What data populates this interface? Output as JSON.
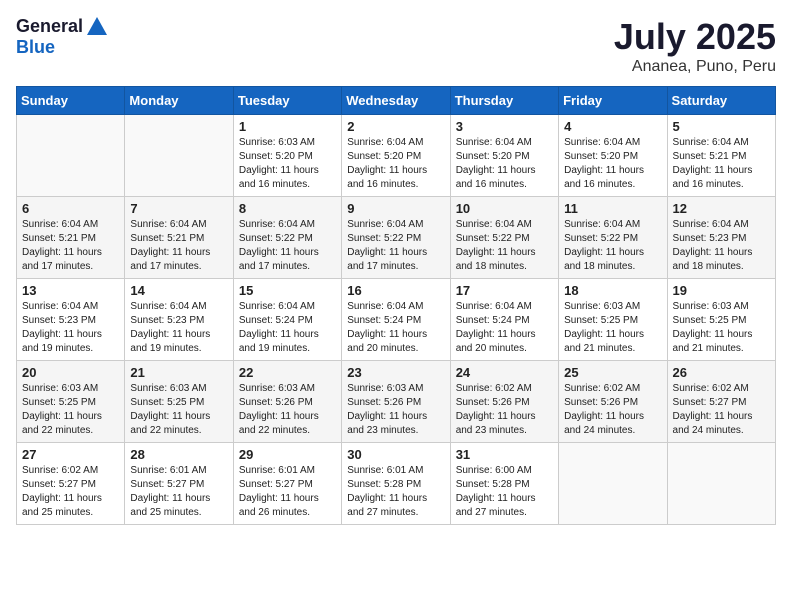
{
  "header": {
    "logo_general": "General",
    "logo_blue": "Blue",
    "month_title": "July 2025",
    "subtitle": "Ananea, Puno, Peru"
  },
  "weekdays": [
    "Sunday",
    "Monday",
    "Tuesday",
    "Wednesday",
    "Thursday",
    "Friday",
    "Saturday"
  ],
  "weeks": [
    [
      {
        "day": "",
        "info": ""
      },
      {
        "day": "",
        "info": ""
      },
      {
        "day": "1",
        "info": "Sunrise: 6:03 AM\nSunset: 5:20 PM\nDaylight: 11 hours and 16 minutes."
      },
      {
        "day": "2",
        "info": "Sunrise: 6:04 AM\nSunset: 5:20 PM\nDaylight: 11 hours and 16 minutes."
      },
      {
        "day": "3",
        "info": "Sunrise: 6:04 AM\nSunset: 5:20 PM\nDaylight: 11 hours and 16 minutes."
      },
      {
        "day": "4",
        "info": "Sunrise: 6:04 AM\nSunset: 5:20 PM\nDaylight: 11 hours and 16 minutes."
      },
      {
        "day": "5",
        "info": "Sunrise: 6:04 AM\nSunset: 5:21 PM\nDaylight: 11 hours and 16 minutes."
      }
    ],
    [
      {
        "day": "6",
        "info": "Sunrise: 6:04 AM\nSunset: 5:21 PM\nDaylight: 11 hours and 17 minutes."
      },
      {
        "day": "7",
        "info": "Sunrise: 6:04 AM\nSunset: 5:21 PM\nDaylight: 11 hours and 17 minutes."
      },
      {
        "day": "8",
        "info": "Sunrise: 6:04 AM\nSunset: 5:22 PM\nDaylight: 11 hours and 17 minutes."
      },
      {
        "day": "9",
        "info": "Sunrise: 6:04 AM\nSunset: 5:22 PM\nDaylight: 11 hours and 17 minutes."
      },
      {
        "day": "10",
        "info": "Sunrise: 6:04 AM\nSunset: 5:22 PM\nDaylight: 11 hours and 18 minutes."
      },
      {
        "day": "11",
        "info": "Sunrise: 6:04 AM\nSunset: 5:22 PM\nDaylight: 11 hours and 18 minutes."
      },
      {
        "day": "12",
        "info": "Sunrise: 6:04 AM\nSunset: 5:23 PM\nDaylight: 11 hours and 18 minutes."
      }
    ],
    [
      {
        "day": "13",
        "info": "Sunrise: 6:04 AM\nSunset: 5:23 PM\nDaylight: 11 hours and 19 minutes."
      },
      {
        "day": "14",
        "info": "Sunrise: 6:04 AM\nSunset: 5:23 PM\nDaylight: 11 hours and 19 minutes."
      },
      {
        "day": "15",
        "info": "Sunrise: 6:04 AM\nSunset: 5:24 PM\nDaylight: 11 hours and 19 minutes."
      },
      {
        "day": "16",
        "info": "Sunrise: 6:04 AM\nSunset: 5:24 PM\nDaylight: 11 hours and 20 minutes."
      },
      {
        "day": "17",
        "info": "Sunrise: 6:04 AM\nSunset: 5:24 PM\nDaylight: 11 hours and 20 minutes."
      },
      {
        "day": "18",
        "info": "Sunrise: 6:03 AM\nSunset: 5:25 PM\nDaylight: 11 hours and 21 minutes."
      },
      {
        "day": "19",
        "info": "Sunrise: 6:03 AM\nSunset: 5:25 PM\nDaylight: 11 hours and 21 minutes."
      }
    ],
    [
      {
        "day": "20",
        "info": "Sunrise: 6:03 AM\nSunset: 5:25 PM\nDaylight: 11 hours and 22 minutes."
      },
      {
        "day": "21",
        "info": "Sunrise: 6:03 AM\nSunset: 5:25 PM\nDaylight: 11 hours and 22 minutes."
      },
      {
        "day": "22",
        "info": "Sunrise: 6:03 AM\nSunset: 5:26 PM\nDaylight: 11 hours and 22 minutes."
      },
      {
        "day": "23",
        "info": "Sunrise: 6:03 AM\nSunset: 5:26 PM\nDaylight: 11 hours and 23 minutes."
      },
      {
        "day": "24",
        "info": "Sunrise: 6:02 AM\nSunset: 5:26 PM\nDaylight: 11 hours and 23 minutes."
      },
      {
        "day": "25",
        "info": "Sunrise: 6:02 AM\nSunset: 5:26 PM\nDaylight: 11 hours and 24 minutes."
      },
      {
        "day": "26",
        "info": "Sunrise: 6:02 AM\nSunset: 5:27 PM\nDaylight: 11 hours and 24 minutes."
      }
    ],
    [
      {
        "day": "27",
        "info": "Sunrise: 6:02 AM\nSunset: 5:27 PM\nDaylight: 11 hours and 25 minutes."
      },
      {
        "day": "28",
        "info": "Sunrise: 6:01 AM\nSunset: 5:27 PM\nDaylight: 11 hours and 25 minutes."
      },
      {
        "day": "29",
        "info": "Sunrise: 6:01 AM\nSunset: 5:27 PM\nDaylight: 11 hours and 26 minutes."
      },
      {
        "day": "30",
        "info": "Sunrise: 6:01 AM\nSunset: 5:28 PM\nDaylight: 11 hours and 27 minutes."
      },
      {
        "day": "31",
        "info": "Sunrise: 6:00 AM\nSunset: 5:28 PM\nDaylight: 11 hours and 27 minutes."
      },
      {
        "day": "",
        "info": ""
      },
      {
        "day": "",
        "info": ""
      }
    ]
  ]
}
